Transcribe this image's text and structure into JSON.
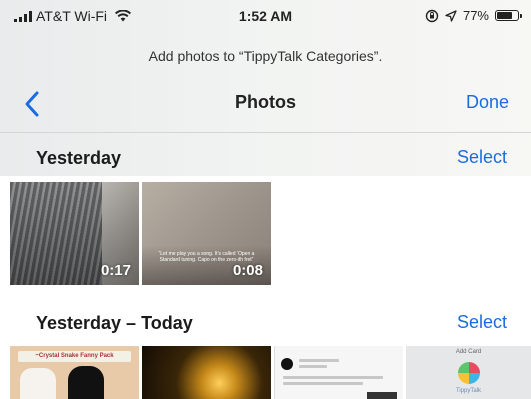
{
  "status_bar": {
    "carrier": "AT&T Wi-Fi",
    "time": "1:52 AM",
    "battery_text": "77%",
    "battery_level": 0.77
  },
  "prompt": "Add photos to “TippyTalk Categories”.",
  "nav": {
    "back_icon": "chevron-left-icon",
    "title": "Photos",
    "done_label": "Done"
  },
  "sections": [
    {
      "title": "Yesterday",
      "select_label": "Select",
      "items": [
        {
          "duration": "0:17"
        },
        {
          "duration": "0:08",
          "caption": "“Let me play you a song. It’s called ‘Open a Standard tuning. Capo on the zero-ith fret”"
        }
      ]
    },
    {
      "title": "Yesterday – Today",
      "select_label": "Select",
      "items": [
        {
          "text": "~Crystal Snake Fanny Pack"
        },
        {
          "text": ""
        },
        {
          "text": ""
        },
        {
          "text": "Add Card",
          "label": "TippyTalk"
        }
      ]
    }
  ],
  "colors": {
    "accent": "#1a6ce0",
    "header_bg": "#eef0ef"
  }
}
